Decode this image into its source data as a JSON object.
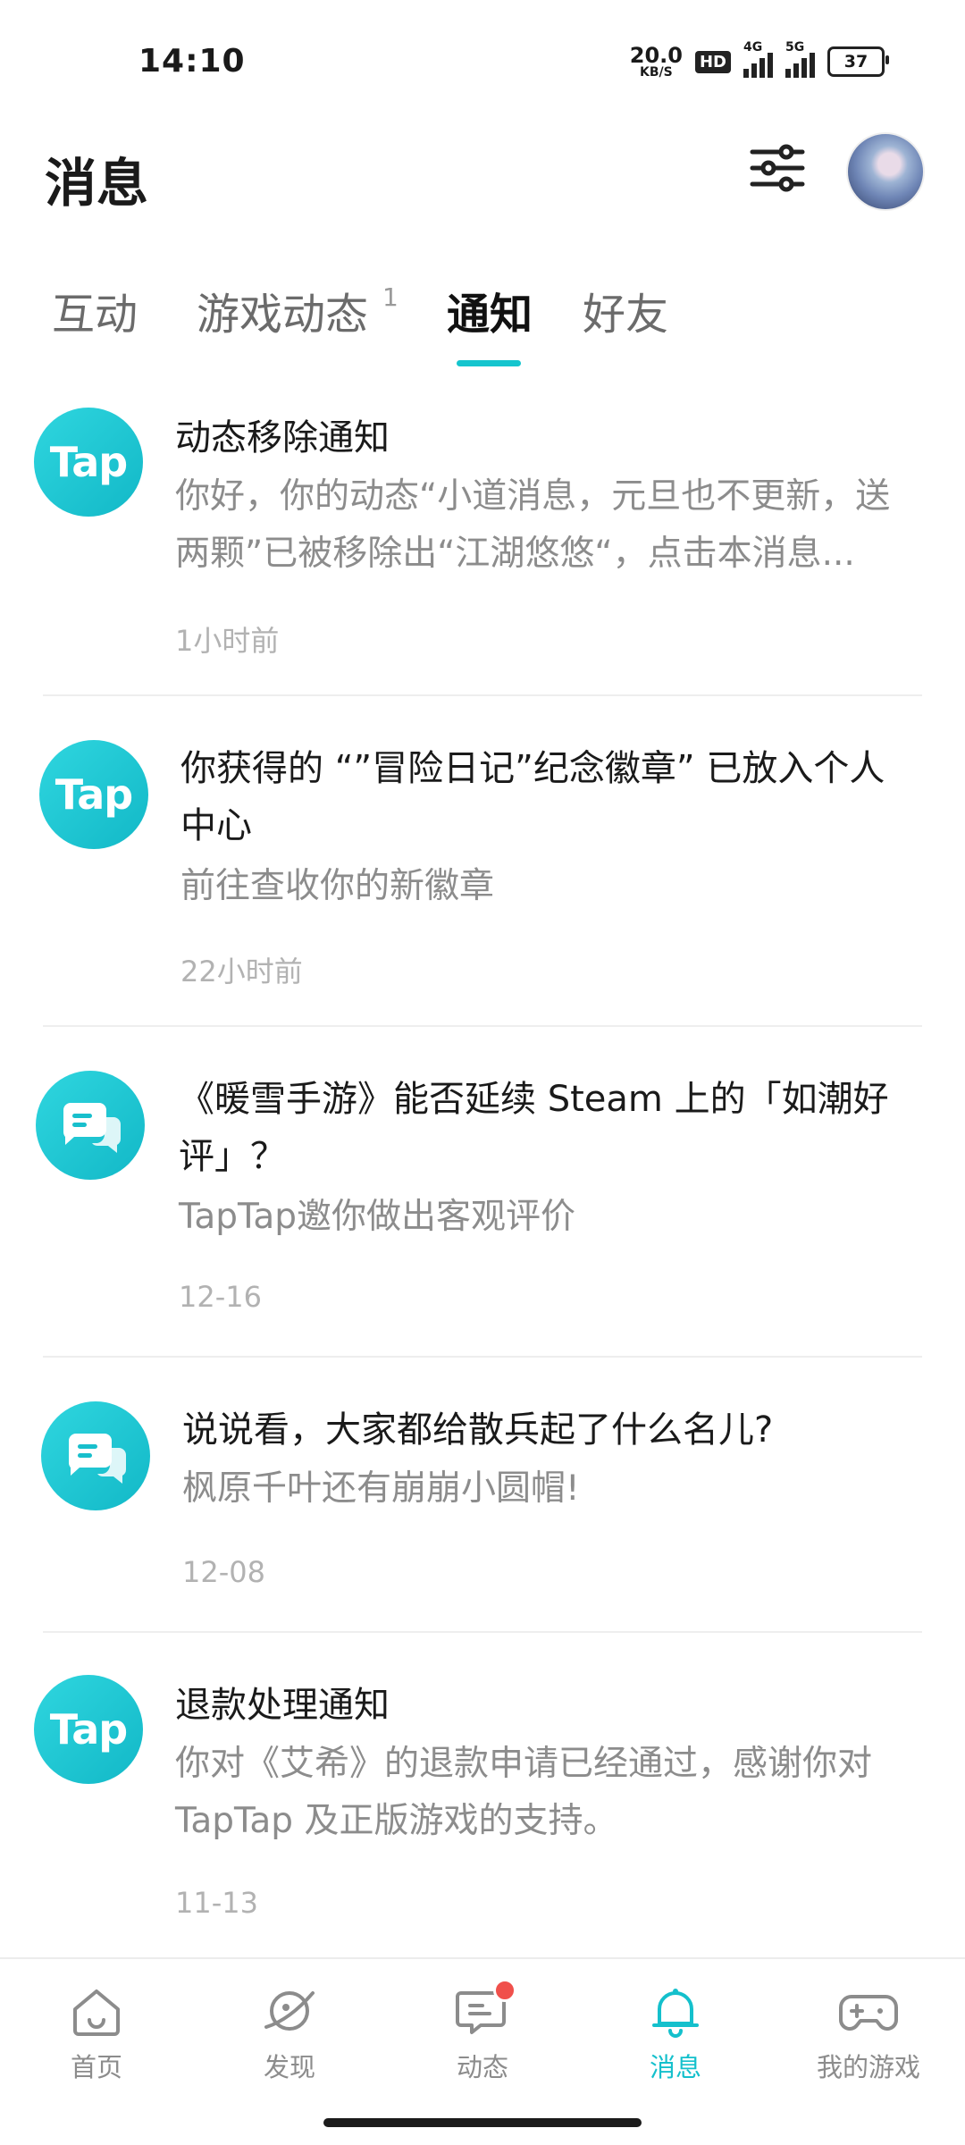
{
  "status_bar": {
    "time": "14:10",
    "net_speed_value": "20.0",
    "net_speed_unit": "KB/S",
    "hd_label": "HD",
    "network_1": "4G",
    "network_2": "5G",
    "battery": "37"
  },
  "header": {
    "title": "消息",
    "filter_icon": "sliders-icon",
    "avatar_icon": "user-avatar"
  },
  "tabs": [
    {
      "label": "互动",
      "badge": ""
    },
    {
      "label": "游戏动态",
      "badge": "1"
    },
    {
      "label": "通知",
      "badge": "",
      "active": true
    },
    {
      "label": "好友",
      "badge": ""
    }
  ],
  "notifications": [
    {
      "icon": "tap-logo",
      "icon_text": "Tap",
      "title": "动态移除通知",
      "body": "你好，你的动态“小道消息，元旦也不更新，送两颗”已被移除出“江湖悠悠“，点击本消息...",
      "time": "1小时前"
    },
    {
      "icon": "tap-logo",
      "icon_text": "Tap",
      "title": "你获得的 “”冒险日记”纪念徽章” 已放入个人中心",
      "body": "前往查收你的新徽章",
      "time": "22小时前"
    },
    {
      "icon": "chat-bubble-icon",
      "icon_text": "",
      "title": "《暖雪手游》能否延续 Steam 上的「如潮好评」？",
      "body": "TapTap邀你做出客观评价",
      "time": "12-16"
    },
    {
      "icon": "chat-bubble-icon",
      "icon_text": "",
      "title": "说说看，大家都给散兵起了什么名儿?",
      "body": "枫原千叶还有崩崩小圆帽!",
      "time": "12-08"
    },
    {
      "icon": "tap-logo",
      "icon_text": "Tap",
      "title": "退款处理通知",
      "body": "你对《艾希》的退款申请已经通过，感谢你对 TapTap 及正版游戏的支持。",
      "time": "11-13"
    }
  ],
  "bottom_nav": [
    {
      "label": "首页",
      "icon": "home-icon"
    },
    {
      "label": "发现",
      "icon": "planet-icon"
    },
    {
      "label": "动态",
      "icon": "feed-chat-icon",
      "has_dot": true
    },
    {
      "label": "消息",
      "icon": "bell-icon",
      "active": true
    },
    {
      "label": "我的游戏",
      "icon": "gamepad-icon"
    }
  ],
  "colors": {
    "accent": "#15c5ce",
    "badge_dot": "#f0504b",
    "text_primary": "#1a1a1a",
    "text_secondary": "#8c8c8c"
  }
}
